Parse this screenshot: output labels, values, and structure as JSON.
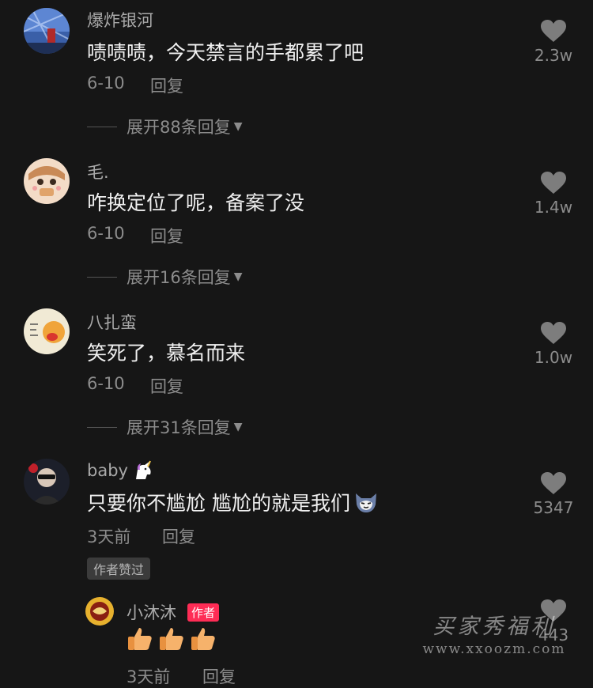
{
  "comments": [
    {
      "username": "爆炸银河",
      "text": "啧啧啧，今天禁言的手都累了吧",
      "date": "6-10",
      "reply_label": "回复",
      "likes": "2.3w",
      "expand_label": "展开88条回复"
    },
    {
      "username": "毛.",
      "text": "咋换定位了呢，备案了没",
      "date": "6-10",
      "reply_label": "回复",
      "likes": "1.4w",
      "expand_label": "展开16条回复"
    },
    {
      "username": "八扎蛮",
      "text": "笑死了，慕名而来",
      "date": "6-10",
      "reply_label": "回复",
      "likes": "1.0w",
      "expand_label": "展开31条回复"
    },
    {
      "username": "baby",
      "text": "只要你不尴尬 尴尬的就是我们",
      "date": "3天前",
      "reply_label": "回复",
      "likes": "5347",
      "badge": "作者赞过"
    }
  ],
  "author_reply": {
    "username": "小沐沐",
    "author_tag": "作者",
    "date": "3天前",
    "reply_label": "回复",
    "likes": "443"
  },
  "watermark": {
    "line1": "买家秀福利",
    "line2": "www.xxoozm.com"
  },
  "icons": {
    "like": "heart-icon",
    "expand": "caret-down-icon",
    "emoji_unicorn": "unicorn-emoji",
    "emoji_cat": "cat-face-emoji",
    "emoji_thumbs": "thumbs-up-emoji"
  },
  "colors": {
    "background": "#161616",
    "author_tag": "#fe2c55"
  }
}
